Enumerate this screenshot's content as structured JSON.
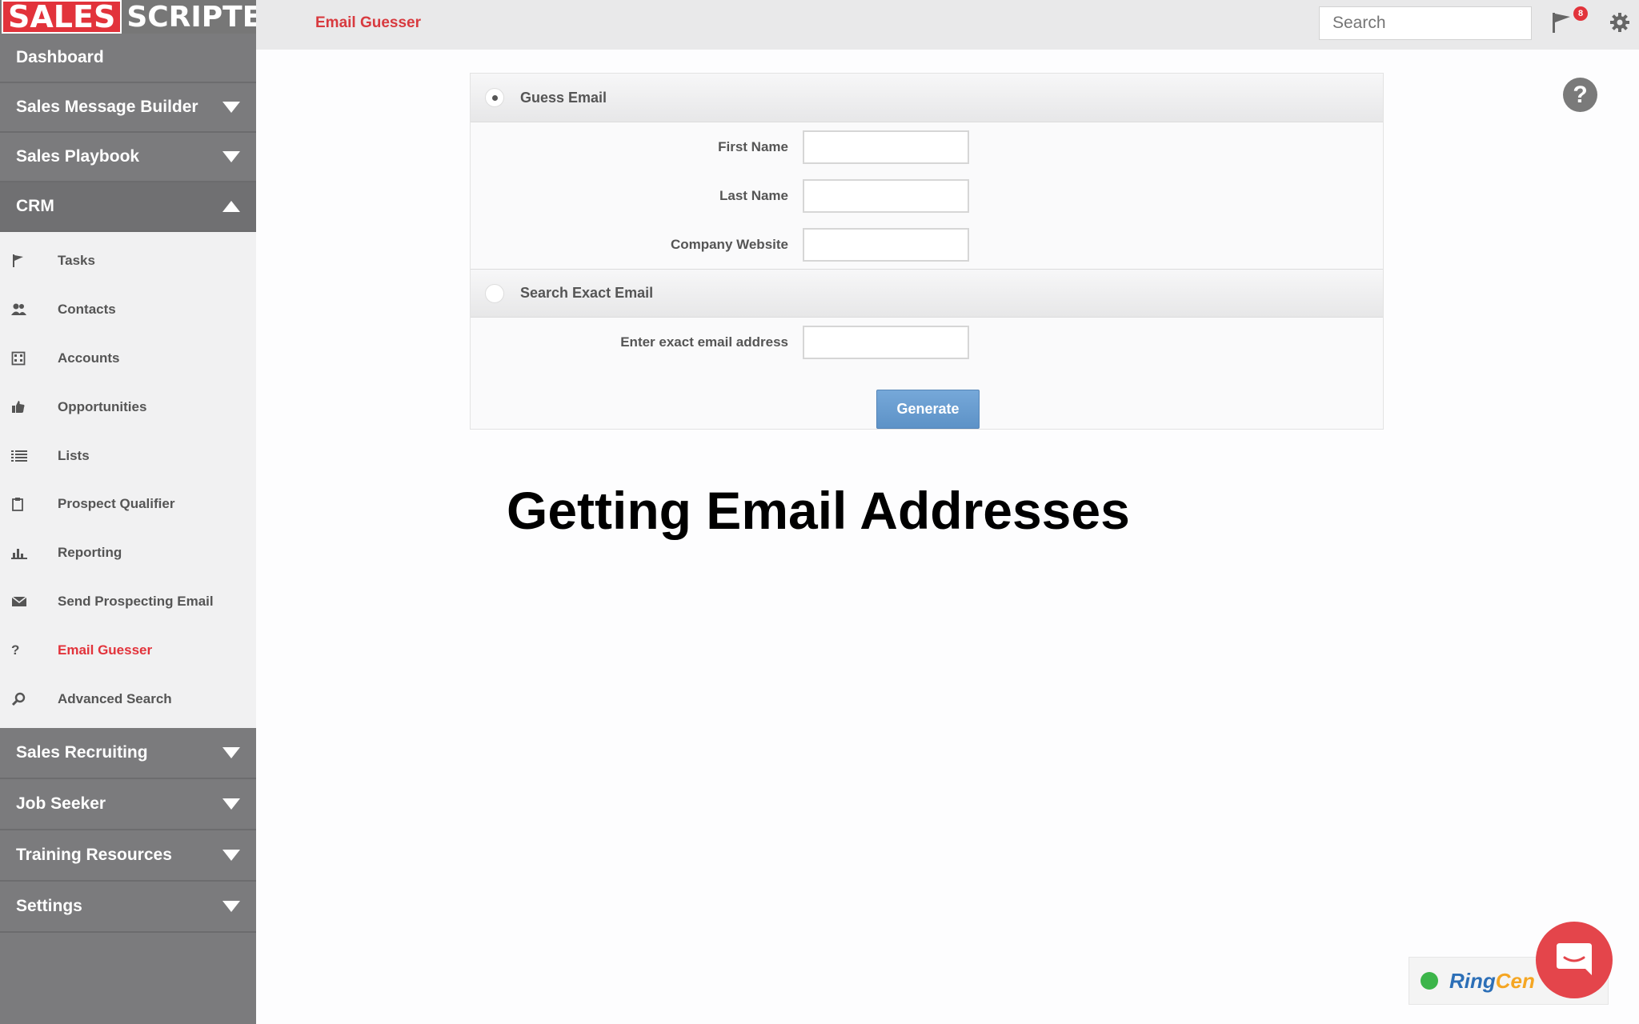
{
  "brand": {
    "part1": "SALES",
    "part2": "SCRIPTER"
  },
  "topbar": {
    "page_title": "Email Guesser",
    "search_placeholder": "Search",
    "notification_count": "8"
  },
  "sidebar": {
    "main_top": [
      {
        "label": "Dashboard",
        "caret": "none"
      },
      {
        "label": "Sales Message Builder",
        "caret": "down"
      },
      {
        "label": "Sales Playbook",
        "caret": "down"
      },
      {
        "label": "CRM",
        "caret": "up"
      }
    ],
    "crm_items": [
      {
        "label": "Tasks",
        "icon": "flag-icon"
      },
      {
        "label": "Contacts",
        "icon": "contacts-icon"
      },
      {
        "label": "Accounts",
        "icon": "building-icon"
      },
      {
        "label": "Opportunities",
        "icon": "thumbs-up-icon"
      },
      {
        "label": "Lists",
        "icon": "list-icon"
      },
      {
        "label": "Prospect Qualifier",
        "icon": "clipboard-icon"
      },
      {
        "label": "Reporting",
        "icon": "bar-chart-icon"
      },
      {
        "label": "Send Prospecting Email",
        "icon": "envelope-icon"
      },
      {
        "label": "Email Guesser",
        "icon": "question-icon",
        "active": true
      },
      {
        "label": "Advanced Search",
        "icon": "search-icon"
      }
    ],
    "main_bottom": [
      {
        "label": "Sales Recruiting"
      },
      {
        "label": "Job Seeker"
      },
      {
        "label": "Training Resources"
      },
      {
        "label": "Settings"
      }
    ]
  },
  "form": {
    "guess_section": "Guess Email",
    "first_name_label": "First Name",
    "last_name_label": "Last Name",
    "company_label": "Company Website",
    "exact_section": "Search Exact Email",
    "exact_label": "Enter exact email address",
    "generate_label": "Generate",
    "first_name_value": "",
    "last_name_value": "",
    "company_value": "",
    "exact_value": ""
  },
  "overlay_heading": "Getting Email Addresses",
  "help_label": "?",
  "widget": {
    "brand_a": "Ring",
    "brand_b": "Cen"
  },
  "colors": {
    "accent": "#e2333b",
    "sidebar": "#7b7b7d",
    "button": "#5d92c7"
  }
}
